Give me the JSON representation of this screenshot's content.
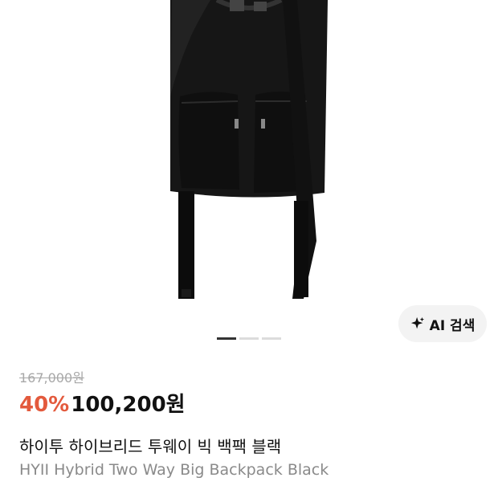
{
  "product": {
    "image_alt": "black backpack",
    "ai_search_label": "AI 검색",
    "carousel": {
      "total": 3,
      "active": 1
    },
    "original_price": "167,000원",
    "discount": "40%",
    "sale_price": "100,200원",
    "title_ko": "하이투 하이브리드 투웨이 빅 백팩 블랙",
    "title_en": "HYII Hybrid Two Way Big Backpack Black"
  },
  "icons": {
    "ai_search": "sparkle-icon"
  },
  "colors": {
    "discount": "#e35a3d",
    "strike": "#a8a8a8",
    "subtitle": "#8a8a8a"
  }
}
